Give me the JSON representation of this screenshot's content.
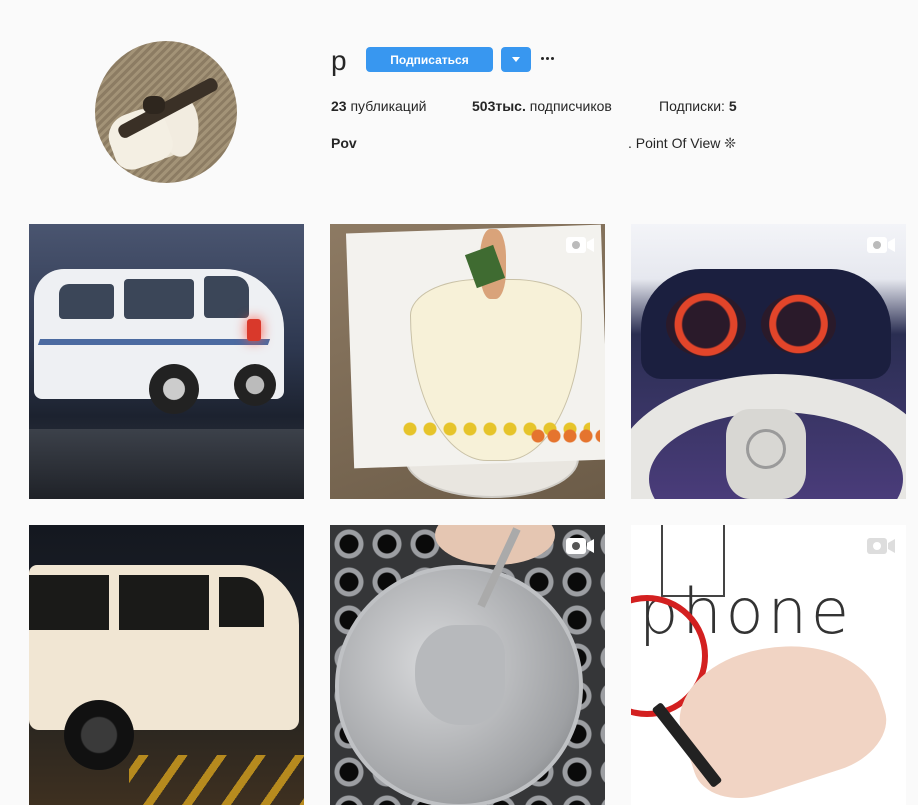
{
  "profile": {
    "username": "p",
    "follow_label": "Подписаться",
    "stats": {
      "posts_count": "23",
      "posts_label": " публикаций",
      "followers_count": "503тыс.",
      "followers_label": " подписчиков",
      "following_label": "Подписки: ",
      "following_count": "5"
    },
    "full_name": "Pov",
    "bio": ". Point Of View ❊"
  },
  "posts": [
    {
      "kind": "photo"
    },
    {
      "kind": "video",
      "icon": "video-camera-icon"
    },
    {
      "kind": "video",
      "icon": "video-camera-icon"
    },
    {
      "kind": "photo"
    },
    {
      "kind": "video",
      "icon": "video-camera-icon"
    },
    {
      "kind": "video",
      "icon": "video-camera-icon"
    }
  ],
  "colors": {
    "accent": "#3897f0",
    "background": "#fafafa",
    "text": "#262626"
  }
}
